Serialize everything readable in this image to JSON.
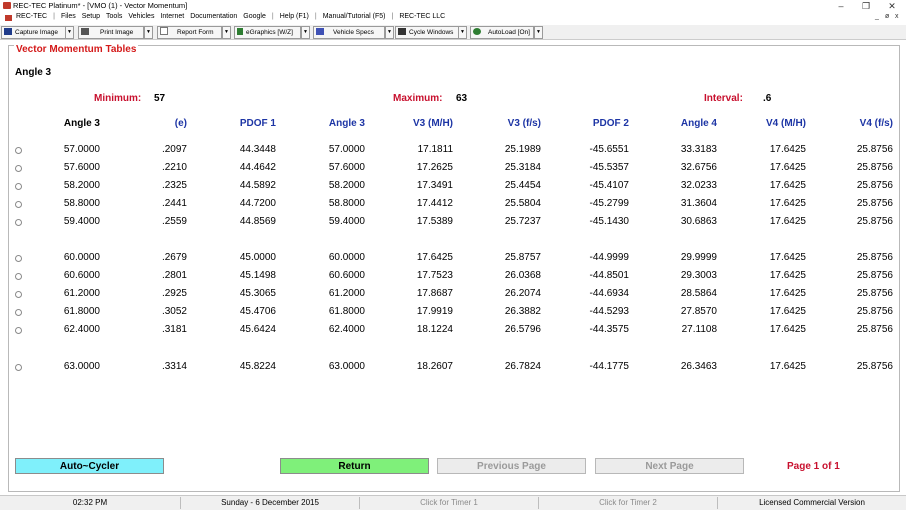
{
  "window": {
    "title": "REC-TEC Platinum* - [VMO (1) - Vector Momentum]",
    "minimize_glyph": "–",
    "restore_glyph": "❐",
    "close_glyph": "✕"
  },
  "menu": {
    "items": [
      "REC-TEC",
      "|",
      "Files",
      "Setup",
      "Tools",
      "Vehicles",
      "Internet",
      "Documentation",
      "Google",
      "|",
      "Help (F1)",
      "|",
      "Manual/Tutorial (F5)",
      "|",
      "REC-TEC LLC"
    ],
    "mdi_controls": [
      "_",
      "ø",
      "x"
    ]
  },
  "toolbar": {
    "buttons": [
      {
        "label": "Capture Image",
        "icon": "camera-icon"
      },
      {
        "label": "Print Image",
        "icon": "printer-icon"
      },
      {
        "label": "Report Form",
        "icon": "document-icon"
      },
      {
        "label": "eGraphics [W/Z]",
        "icon": "pencil-icon"
      },
      {
        "label": "Vehicle Specs",
        "icon": "car-icon"
      },
      {
        "label": "Cycle Windows",
        "icon": "binoculars-icon"
      },
      {
        "label": "AutoLoad [On]",
        "icon": "gear-icon"
      }
    ],
    "dropdown_glyph": "▼"
  },
  "main": {
    "group_title": "Vector Momentum Tables",
    "section_title": "Angle 3",
    "minimum_label": "Minimum:",
    "minimum_value": "57",
    "maximum_label": "Maximum:",
    "maximum_value": "63",
    "interval_label": "Interval:",
    "interval_value": ".6",
    "columns": [
      "Angle 3",
      "(e)",
      "PDOF 1",
      "Angle 3",
      "V3 (M/H)",
      "V3 (f/s)",
      "PDOF 2",
      "Angle 4",
      "V4 (M/H)",
      "V4 (f/s)"
    ],
    "rows": [
      [
        "57.0000",
        ".2097",
        "44.3448",
        "57.0000",
        "17.1811",
        "25.1989",
        "-45.6551",
        "33.3183",
        "17.6425",
        "25.8756"
      ],
      [
        "57.6000",
        ".2210",
        "44.4642",
        "57.6000",
        "17.2625",
        "25.3184",
        "-45.5357",
        "32.6756",
        "17.6425",
        "25.8756"
      ],
      [
        "58.2000",
        ".2325",
        "44.5892",
        "58.2000",
        "17.3491",
        "25.4454",
        "-45.4107",
        "32.0233",
        "17.6425",
        "25.8756"
      ],
      [
        "58.8000",
        ".2441",
        "44.7200",
        "58.8000",
        "17.4412",
        "25.5804",
        "-45.2799",
        "31.3604",
        "17.6425",
        "25.8756"
      ],
      [
        "59.4000",
        ".2559",
        "44.8569",
        "59.4000",
        "17.5389",
        "25.7237",
        "-45.1430",
        "30.6863",
        "17.6425",
        "25.8756"
      ],
      [
        "60.0000",
        ".2679",
        "45.0000",
        "60.0000",
        "17.6425",
        "25.8757",
        "-44.9999",
        "29.9999",
        "17.6425",
        "25.8756"
      ],
      [
        "60.6000",
        ".2801",
        "45.1498",
        "60.6000",
        "17.7523",
        "26.0368",
        "-44.8501",
        "29.3003",
        "17.6425",
        "25.8756"
      ],
      [
        "61.2000",
        ".2925",
        "45.3065",
        "61.2000",
        "17.8687",
        "26.2074",
        "-44.6934",
        "28.5864",
        "17.6425",
        "25.8756"
      ],
      [
        "61.8000",
        ".3052",
        "45.4706",
        "61.8000",
        "17.9919",
        "26.3882",
        "-44.5293",
        "27.8570",
        "17.6425",
        "25.8756"
      ],
      [
        "62.4000",
        ".3181",
        "45.6424",
        "62.4000",
        "18.1224",
        "26.5796",
        "-44.3575",
        "27.1108",
        "17.6425",
        "25.8756"
      ],
      [
        "63.0000",
        ".3314",
        "45.8224",
        "63.0000",
        "18.2607",
        "26.7824",
        "-44.1775",
        "26.3463",
        "17.6425",
        "25.8756"
      ]
    ]
  },
  "buttons": {
    "auto_cycler": "Auto~Cycler",
    "return": "Return",
    "previous_page": "Previous Page",
    "next_page": "Next Page"
  },
  "page_info": "Page  1 of  1",
  "status": {
    "time": "02:32 PM",
    "date": "Sunday  -  6 December 2015",
    "timer1": "Click for Timer 1",
    "timer2": "Click for Timer 2",
    "license": "Licensed Commercial Version"
  },
  "colors": {
    "accent_red": "#c8102e",
    "header_blue": "#1d35a5",
    "auto_cycler_bg": "#7ff0fb",
    "return_bg": "#7ff07a",
    "disabled_bg": "#ececec"
  }
}
